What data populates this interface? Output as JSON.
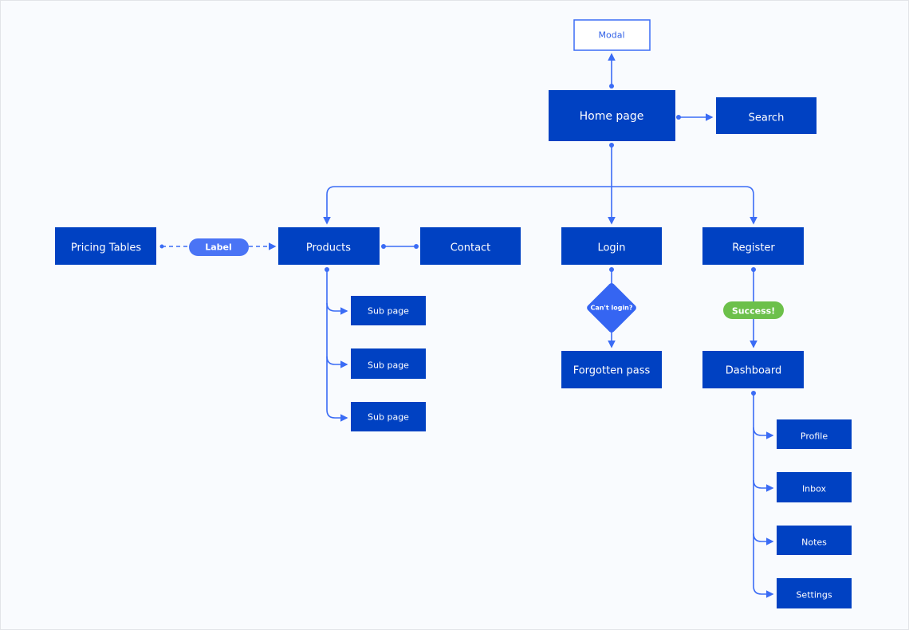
{
  "nodes": {
    "modal": "Modal",
    "home": "Home page",
    "search": "Search",
    "pricing": "Pricing Tables",
    "products": "Products",
    "contact": "Contact",
    "login": "Login",
    "register": "Register",
    "sub_pages": [
      "Sub page",
      "Sub page",
      "Sub page"
    ],
    "forgotten": "Forgotten pass",
    "dashboard": "Dashboard",
    "dashboard_children": [
      "Profile",
      "Inbox",
      "Notes",
      "Settings"
    ]
  },
  "labels": {
    "label_pill": "Label",
    "decision": "Can't login?",
    "success": "Success!"
  },
  "colors": {
    "node": "#0041c2",
    "connector": "#3b6cf5",
    "label_pill": "#4a74f5",
    "success": "#6cc04a",
    "background": "#f9fbfe"
  }
}
